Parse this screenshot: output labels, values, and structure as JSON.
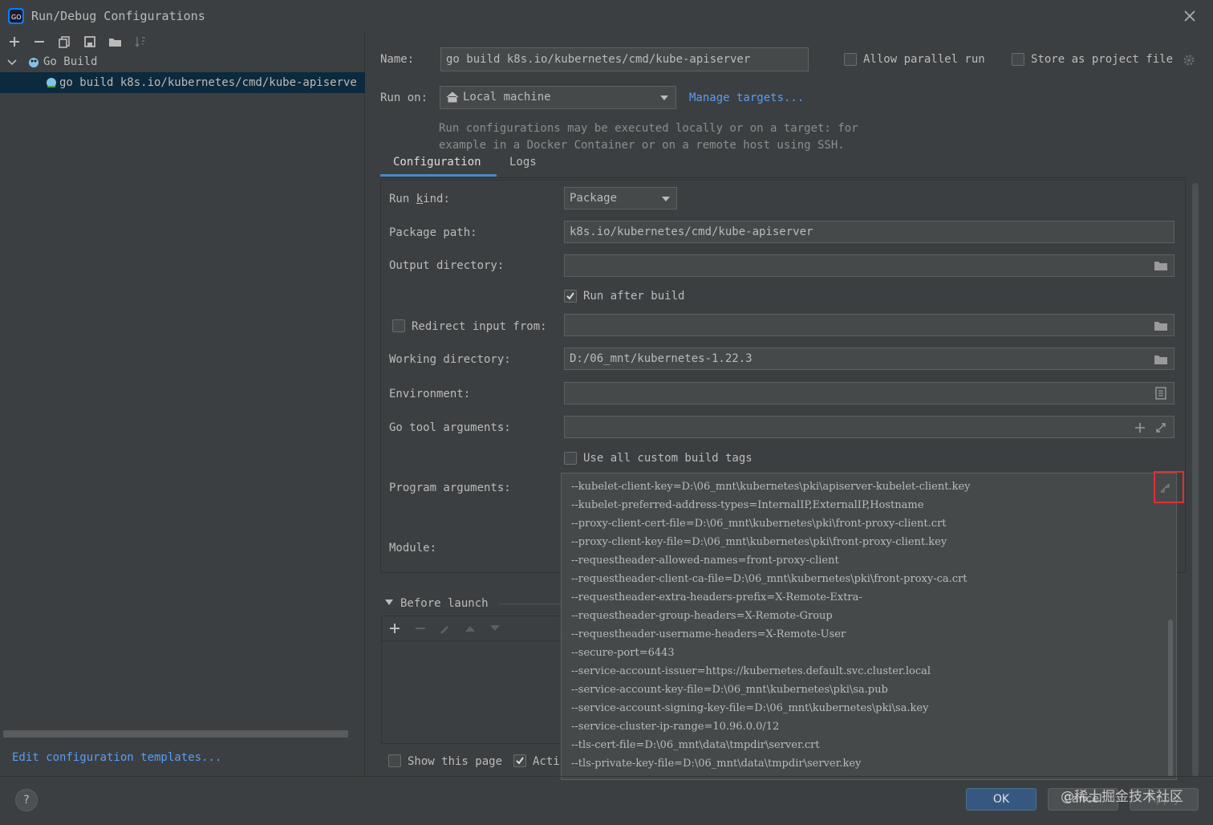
{
  "window": {
    "title": "Run/Debug Configurations"
  },
  "toolbar": {
    "icons": [
      "add-icon",
      "remove-icon",
      "copy-icon",
      "save-icon",
      "folder-icon",
      "sort-icon"
    ]
  },
  "tree": {
    "group_label": "Go Build",
    "item_label": "go build k8s.io/kubernetes/cmd/kube-apiserve"
  },
  "left_footer": {
    "edit_templates_link": "Edit configuration templates..."
  },
  "header": {
    "name_label": "Name:",
    "name_value": "go build k8s.io/kubernetes/cmd/kube-apiserver",
    "allow_parallel_label": "Allow parallel run",
    "store_project_label": "Store as project file",
    "run_on_label": "Run on:",
    "run_on_value": "Local machine",
    "manage_targets_link": "Manage targets...",
    "hint_line1": "Run configurations may be executed locally or on a target: for",
    "hint_line2": "example in a Docker Container or on a remote host using SSH."
  },
  "tabs": [
    {
      "label": "Configuration",
      "active": true
    },
    {
      "label": "Logs",
      "active": false
    }
  ],
  "config": {
    "run_kind_label": "Run kind:",
    "run_kind_value": "Package",
    "package_path_label": "Package path:",
    "package_path_value": "k8s.io/kubernetes/cmd/kube-apiserver",
    "output_dir_label": "Output directory:",
    "output_dir_value": "",
    "run_after_build_label": "Run after build",
    "run_after_build_checked": true,
    "redirect_input_label": "Redirect input from:",
    "redirect_input_value": "",
    "working_dir_label": "Working directory:",
    "working_dir_value": "D:/06_mnt/kubernetes-1.22.3",
    "environment_label": "Environment:",
    "environment_value": "",
    "go_tool_args_label": "Go tool arguments:",
    "go_tool_args_value": "",
    "use_custom_tags_label": "Use all custom build tags",
    "program_args_label": "Program arguments:",
    "module_label": "Module:",
    "program_args_lines": [
      "--kubelet-client-key=D:\\06_mnt\\kubernetes\\pki\\apiserver-kubelet-client.key",
      "--kubelet-preferred-address-types=InternalIP,ExternalIP,Hostname",
      "--proxy-client-cert-file=D:\\06_mnt\\kubernetes\\pki\\front-proxy-client.crt",
      "--proxy-client-key-file=D:\\06_mnt\\kubernetes\\pki\\front-proxy-client.key",
      "--requestheader-allowed-names=front-proxy-client",
      "--requestheader-client-ca-file=D:\\06_mnt\\kubernetes\\pki\\front-proxy-ca.crt",
      "--requestheader-extra-headers-prefix=X-Remote-Extra-",
      "--requestheader-group-headers=X-Remote-Group",
      "--requestheader-username-headers=X-Remote-User",
      "--secure-port=6443",
      "--service-account-issuer=https://kubernetes.default.svc.cluster.local",
      "--service-account-key-file=D:\\06_mnt\\kubernetes\\pki\\sa.pub",
      "--service-account-signing-key-file=D:\\06_mnt\\kubernetes\\pki\\sa.key",
      "--service-cluster-ip-range=10.96.0.0/12",
      "--tls-cert-file=D:\\06_mnt\\data\\tmpdir\\server.crt",
      "--tls-private-key-file=D:\\06_mnt\\data\\tmpdir\\server.key"
    ]
  },
  "before_launch": {
    "label": "Before launch"
  },
  "footer": {
    "show_page_label": "Show this page",
    "activate_label": "Acti",
    "ok_label": "OK",
    "cancel_label": "Cancel",
    "apply_label": "Apply",
    "help_label": "?"
  },
  "watermark": "@稀土掘金技术社区",
  "colors": {
    "accent": "#589df6",
    "selection": "#0d293e",
    "highlight_box": "#e03030",
    "primary_button": "#365880"
  }
}
